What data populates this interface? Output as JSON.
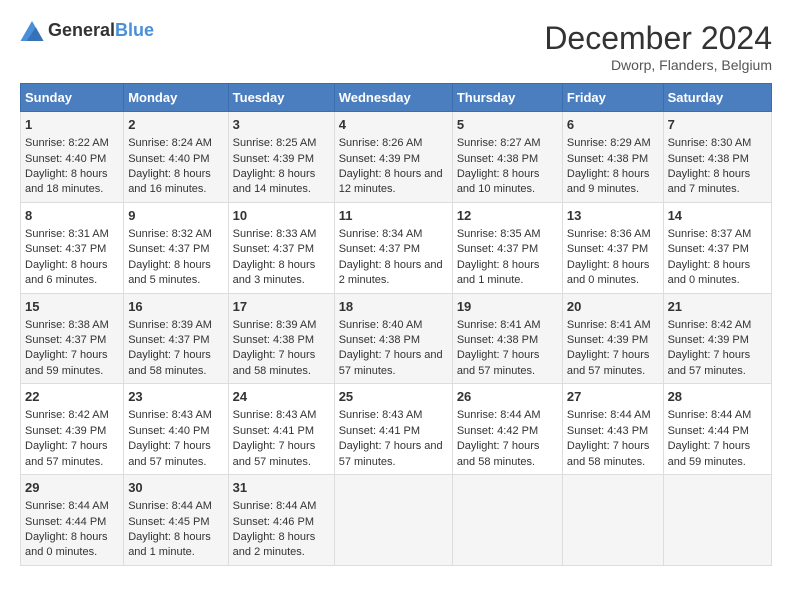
{
  "logo": {
    "text_general": "General",
    "text_blue": "Blue"
  },
  "title": "December 2024",
  "subtitle": "Dworp, Flanders, Belgium",
  "days_of_week": [
    "Sunday",
    "Monday",
    "Tuesday",
    "Wednesday",
    "Thursday",
    "Friday",
    "Saturday"
  ],
  "weeks": [
    [
      {
        "day": "1",
        "sunrise": "Sunrise: 8:22 AM",
        "sunset": "Sunset: 4:40 PM",
        "daylight": "Daylight: 8 hours and 18 minutes."
      },
      {
        "day": "2",
        "sunrise": "Sunrise: 8:24 AM",
        "sunset": "Sunset: 4:40 PM",
        "daylight": "Daylight: 8 hours and 16 minutes."
      },
      {
        "day": "3",
        "sunrise": "Sunrise: 8:25 AM",
        "sunset": "Sunset: 4:39 PM",
        "daylight": "Daylight: 8 hours and 14 minutes."
      },
      {
        "day": "4",
        "sunrise": "Sunrise: 8:26 AM",
        "sunset": "Sunset: 4:39 PM",
        "daylight": "Daylight: 8 hours and 12 minutes."
      },
      {
        "day": "5",
        "sunrise": "Sunrise: 8:27 AM",
        "sunset": "Sunset: 4:38 PM",
        "daylight": "Daylight: 8 hours and 10 minutes."
      },
      {
        "day": "6",
        "sunrise": "Sunrise: 8:29 AM",
        "sunset": "Sunset: 4:38 PM",
        "daylight": "Daylight: 8 hours and 9 minutes."
      },
      {
        "day": "7",
        "sunrise": "Sunrise: 8:30 AM",
        "sunset": "Sunset: 4:38 PM",
        "daylight": "Daylight: 8 hours and 7 minutes."
      }
    ],
    [
      {
        "day": "8",
        "sunrise": "Sunrise: 8:31 AM",
        "sunset": "Sunset: 4:37 PM",
        "daylight": "Daylight: 8 hours and 6 minutes."
      },
      {
        "day": "9",
        "sunrise": "Sunrise: 8:32 AM",
        "sunset": "Sunset: 4:37 PM",
        "daylight": "Daylight: 8 hours and 5 minutes."
      },
      {
        "day": "10",
        "sunrise": "Sunrise: 8:33 AM",
        "sunset": "Sunset: 4:37 PM",
        "daylight": "Daylight: 8 hours and 3 minutes."
      },
      {
        "day": "11",
        "sunrise": "Sunrise: 8:34 AM",
        "sunset": "Sunset: 4:37 PM",
        "daylight": "Daylight: 8 hours and 2 minutes."
      },
      {
        "day": "12",
        "sunrise": "Sunrise: 8:35 AM",
        "sunset": "Sunset: 4:37 PM",
        "daylight": "Daylight: 8 hours and 1 minute."
      },
      {
        "day": "13",
        "sunrise": "Sunrise: 8:36 AM",
        "sunset": "Sunset: 4:37 PM",
        "daylight": "Daylight: 8 hours and 0 minutes."
      },
      {
        "day": "14",
        "sunrise": "Sunrise: 8:37 AM",
        "sunset": "Sunset: 4:37 PM",
        "daylight": "Daylight: 8 hours and 0 minutes."
      }
    ],
    [
      {
        "day": "15",
        "sunrise": "Sunrise: 8:38 AM",
        "sunset": "Sunset: 4:37 PM",
        "daylight": "Daylight: 7 hours and 59 minutes."
      },
      {
        "day": "16",
        "sunrise": "Sunrise: 8:39 AM",
        "sunset": "Sunset: 4:37 PM",
        "daylight": "Daylight: 7 hours and 58 minutes."
      },
      {
        "day": "17",
        "sunrise": "Sunrise: 8:39 AM",
        "sunset": "Sunset: 4:38 PM",
        "daylight": "Daylight: 7 hours and 58 minutes."
      },
      {
        "day": "18",
        "sunrise": "Sunrise: 8:40 AM",
        "sunset": "Sunset: 4:38 PM",
        "daylight": "Daylight: 7 hours and 57 minutes."
      },
      {
        "day": "19",
        "sunrise": "Sunrise: 8:41 AM",
        "sunset": "Sunset: 4:38 PM",
        "daylight": "Daylight: 7 hours and 57 minutes."
      },
      {
        "day": "20",
        "sunrise": "Sunrise: 8:41 AM",
        "sunset": "Sunset: 4:39 PM",
        "daylight": "Daylight: 7 hours and 57 minutes."
      },
      {
        "day": "21",
        "sunrise": "Sunrise: 8:42 AM",
        "sunset": "Sunset: 4:39 PM",
        "daylight": "Daylight: 7 hours and 57 minutes."
      }
    ],
    [
      {
        "day": "22",
        "sunrise": "Sunrise: 8:42 AM",
        "sunset": "Sunset: 4:39 PM",
        "daylight": "Daylight: 7 hours and 57 minutes."
      },
      {
        "day": "23",
        "sunrise": "Sunrise: 8:43 AM",
        "sunset": "Sunset: 4:40 PM",
        "daylight": "Daylight: 7 hours and 57 minutes."
      },
      {
        "day": "24",
        "sunrise": "Sunrise: 8:43 AM",
        "sunset": "Sunset: 4:41 PM",
        "daylight": "Daylight: 7 hours and 57 minutes."
      },
      {
        "day": "25",
        "sunrise": "Sunrise: 8:43 AM",
        "sunset": "Sunset: 4:41 PM",
        "daylight": "Daylight: 7 hours and 57 minutes."
      },
      {
        "day": "26",
        "sunrise": "Sunrise: 8:44 AM",
        "sunset": "Sunset: 4:42 PM",
        "daylight": "Daylight: 7 hours and 58 minutes."
      },
      {
        "day": "27",
        "sunrise": "Sunrise: 8:44 AM",
        "sunset": "Sunset: 4:43 PM",
        "daylight": "Daylight: 7 hours and 58 minutes."
      },
      {
        "day": "28",
        "sunrise": "Sunrise: 8:44 AM",
        "sunset": "Sunset: 4:44 PM",
        "daylight": "Daylight: 7 hours and 59 minutes."
      }
    ],
    [
      {
        "day": "29",
        "sunrise": "Sunrise: 8:44 AM",
        "sunset": "Sunset: 4:44 PM",
        "daylight": "Daylight: 8 hours and 0 minutes."
      },
      {
        "day": "30",
        "sunrise": "Sunrise: 8:44 AM",
        "sunset": "Sunset: 4:45 PM",
        "daylight": "Daylight: 8 hours and 1 minute."
      },
      {
        "day": "31",
        "sunrise": "Sunrise: 8:44 AM",
        "sunset": "Sunset: 4:46 PM",
        "daylight": "Daylight: 8 hours and 2 minutes."
      },
      null,
      null,
      null,
      null
    ]
  ]
}
